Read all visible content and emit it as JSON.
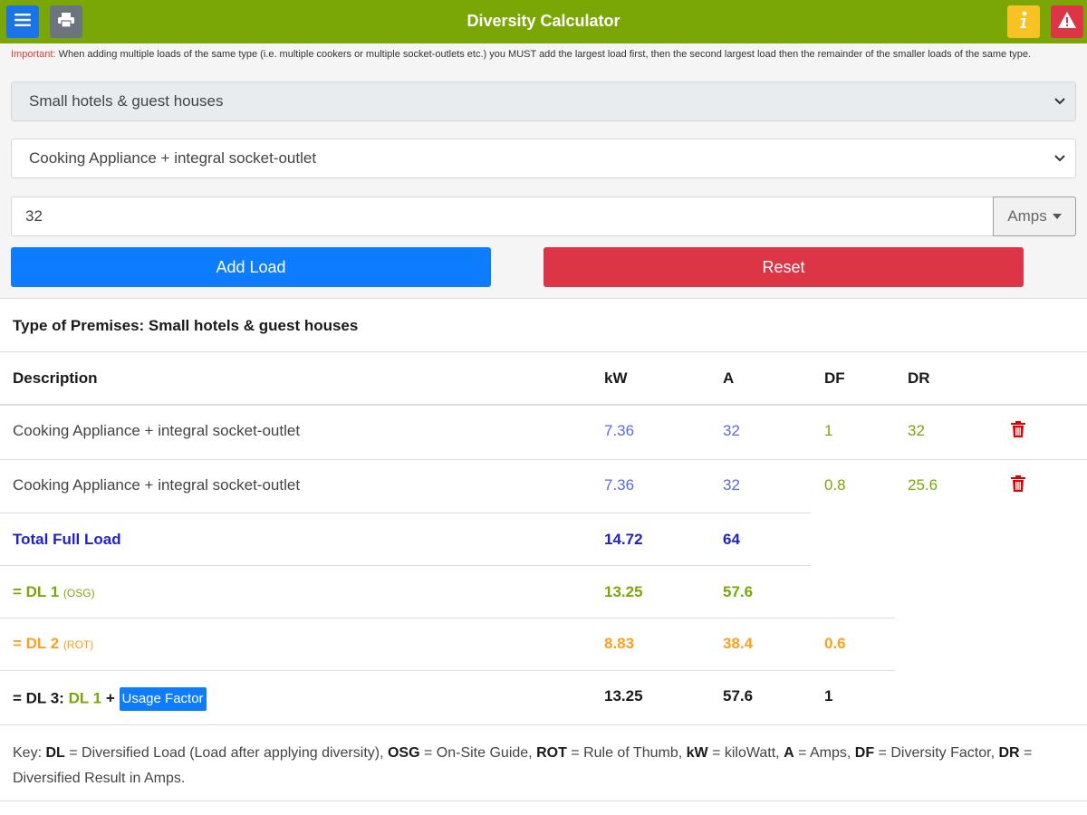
{
  "header": {
    "title": "Diversity Calculator",
    "menu_icon": "hamburger-menu-icon",
    "print_icon": "printer-icon",
    "info_icon": "info-icon",
    "warning_icon": "warning-icon",
    "colors": {
      "bar": "#7aa705",
      "menu": "#1a73e8",
      "print": "#6c757d",
      "info": "#f7c324",
      "warning": "#dc3545"
    }
  },
  "notice": {
    "label": "Important:",
    "text": " When adding multiple loads of the same type (i.e. multiple cookers or multiple socket-outlets etc.) you MUST add the largest load first, then the second largest load then the remainder of the smaller loads of the same type."
  },
  "form": {
    "premises_selected": "Small hotels & guest houses",
    "appliance_selected": "Cooking Appliance + integral socket-outlet",
    "value": "32",
    "unit": "Amps",
    "add_label": "Add Load",
    "reset_label": "Reset"
  },
  "results": {
    "premises_label": "Type of Premises: Small hotels & guest houses",
    "headers": {
      "description": "Description",
      "kw": "kW",
      "a": "A",
      "df": "DF",
      "dr": "DR"
    },
    "rows": [
      {
        "description": "Cooking Appliance + integral socket-outlet",
        "kw": "7.36",
        "a": "32",
        "df": "1",
        "dr": "32"
      },
      {
        "description": "Cooking Appliance + integral socket-outlet",
        "kw": "7.36",
        "a": "32",
        "df": "0.8",
        "dr": "25.6"
      }
    ],
    "total": {
      "label": "Total Full Load",
      "kw": "14.72",
      "a": "64"
    },
    "dl1": {
      "label": "= DL 1",
      "note": "(OSG)",
      "kw": "13.25",
      "a": "57.6"
    },
    "dl2": {
      "label": "= DL 2",
      "note": "(ROT)",
      "kw": "8.83",
      "a": "38.4",
      "df": "0.6"
    },
    "dl3": {
      "prefix": "= DL 3: ",
      "ref": "DL 1",
      "plus": " + ",
      "badge": "Usage Factor",
      "kw": "13.25",
      "a": "57.6",
      "df": "1"
    }
  },
  "key": {
    "prefix": "Key: ",
    "items": [
      {
        "term": "DL",
        "def": " = Diversified Load (Load after applying diversity), "
      },
      {
        "term": "OSG",
        "def": " = On-Site Guide, "
      },
      {
        "term": "ROT",
        "def": " = Rule of Thumb, "
      },
      {
        "term": "kW",
        "def": " = kiloWatt, "
      },
      {
        "term": "A",
        "def": " = Amps, "
      },
      {
        "term": "DF",
        "def": " = Diversity Factor, "
      },
      {
        "term": "DR",
        "def": " = Diversified Result in Amps."
      }
    ]
  }
}
